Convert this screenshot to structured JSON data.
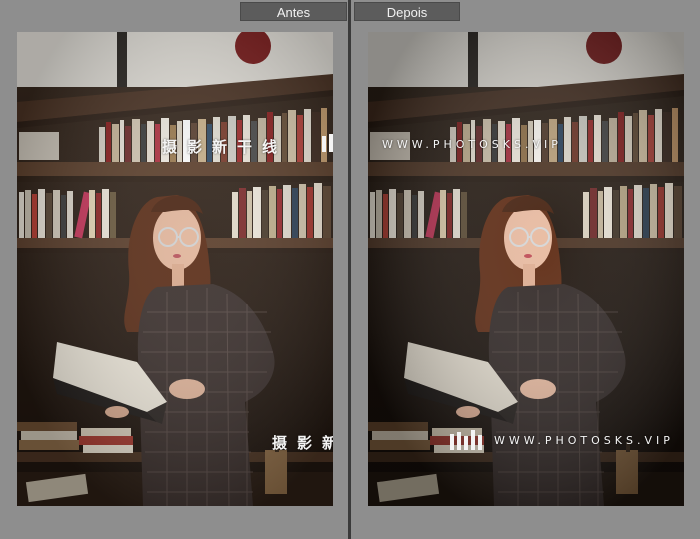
{
  "compare": {
    "before_label": "Antes",
    "after_label": "Depois"
  },
  "watermark": {
    "brand_cn": "摄影新干线",
    "url": "WWW.PHOTOSKS.VIP"
  },
  "colors": {
    "background": "#8e8e8e",
    "tab": "#5c5c5c",
    "divider": "#3a3a3a"
  }
}
